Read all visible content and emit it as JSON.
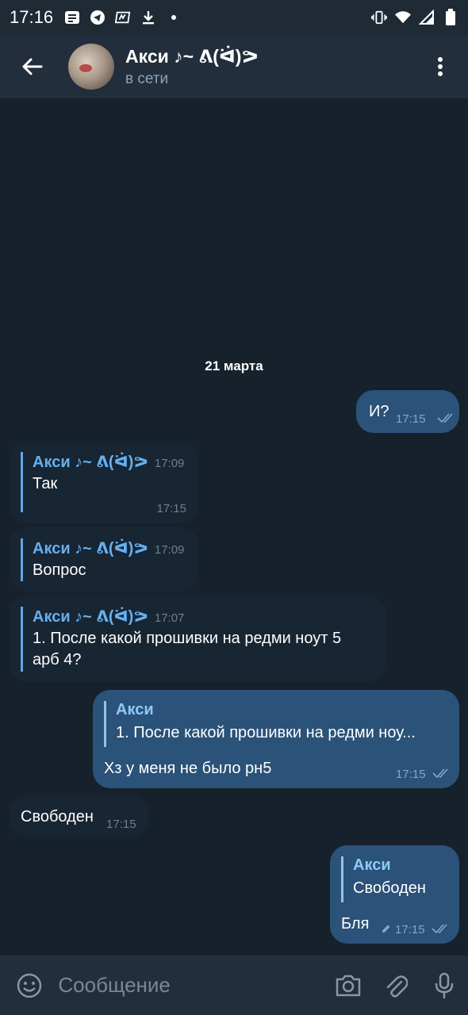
{
  "status_bar": {
    "time": "17:16",
    "left_icons": [
      "news-icon",
      "telegram-icon",
      "memo-icon",
      "download-icon",
      "dot-icon"
    ],
    "right_icons": [
      "vibrate-icon",
      "wifi-icon",
      "signal-icon",
      "battery-icon"
    ]
  },
  "header": {
    "name": "Акси ♪~ ᕕ(ᐛ)ᕗ",
    "status": "в сети"
  },
  "date_separator": "21 марта",
  "messages": [
    {
      "type": "out",
      "text": "И?",
      "time": "17:15",
      "read": true
    },
    {
      "type": "in",
      "fwd_name": "Акси ♪~ ᕕ(ᐛ)ᕗ",
      "fwd_time": "17:09",
      "text": "Так",
      "time": "17:15"
    },
    {
      "type": "in",
      "fwd_name": "Акси ♪~ ᕕ(ᐛ)ᕗ",
      "fwd_time": "17:09",
      "text": "Вопрос"
    },
    {
      "type": "in",
      "fwd_name": "Акси ♪~ ᕕ(ᐛ)ᕗ",
      "fwd_time": "17:07",
      "text_line1": "1. После какой прошивки на редми ноут 5",
      "text_line2": "арб 4?"
    },
    {
      "type": "out",
      "reply_name": "Акси",
      "reply_text": "1. После какой прошивки на редми ноу...",
      "text": "Хз у меня не было рн5",
      "time": "17:15",
      "read": true
    },
    {
      "type": "in",
      "text": "Свободен",
      "time": "17:15"
    },
    {
      "type": "out",
      "reply_name": "Акси",
      "reply_text": "Свободен",
      "text": "Бля",
      "time": "17:15",
      "edited": true,
      "read": true
    }
  ],
  "input": {
    "placeholder": "Сообщение"
  },
  "colors": {
    "background": "#17212b",
    "header": "#232e3c",
    "incoming": "#182533",
    "outgoing": "#2b5278",
    "accent": "#64b1f0"
  }
}
